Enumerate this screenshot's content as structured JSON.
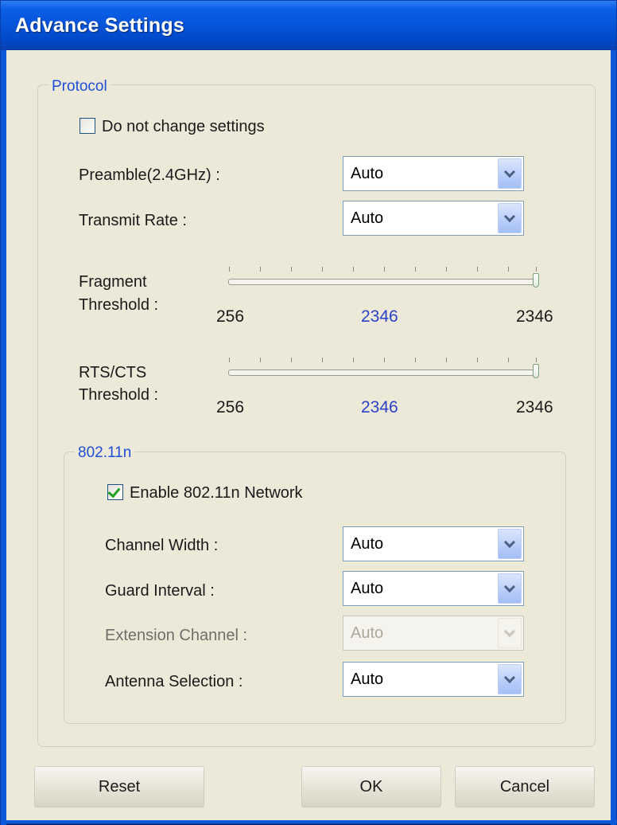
{
  "window": {
    "title": "Advance Settings"
  },
  "protocol": {
    "legend": "Protocol",
    "do_not_change": {
      "label": "Do not change settings",
      "checked": false
    },
    "preamble": {
      "label": "Preamble(2.4GHz) :",
      "value": "Auto"
    },
    "transmit_rate": {
      "label": "Transmit Rate :",
      "value": "Auto"
    },
    "fragment": {
      "label_line1": "Fragment",
      "label_line2": "Threshold :",
      "min": "256",
      "current": "2346",
      "max": "2346"
    },
    "rts": {
      "label_line1": "RTS/CTS",
      "label_line2": "Threshold :",
      "min": "256",
      "current": "2346",
      "max": "2346"
    }
  },
  "n80211": {
    "legend": "802.11n",
    "enable": {
      "label": "Enable 802.11n Network",
      "checked": true
    },
    "channel_width": {
      "label": "Channel Width :",
      "value": "Auto"
    },
    "guard_interval": {
      "label": "Guard Interval :",
      "value": "Auto"
    },
    "extension_channel": {
      "label": "Extension Channel :",
      "value": "Auto",
      "disabled": true
    },
    "antenna_selection": {
      "label": "Antenna Selection :",
      "value": "Auto"
    }
  },
  "buttons": {
    "reset": "Reset",
    "ok": "OK",
    "cancel": "Cancel"
  }
}
